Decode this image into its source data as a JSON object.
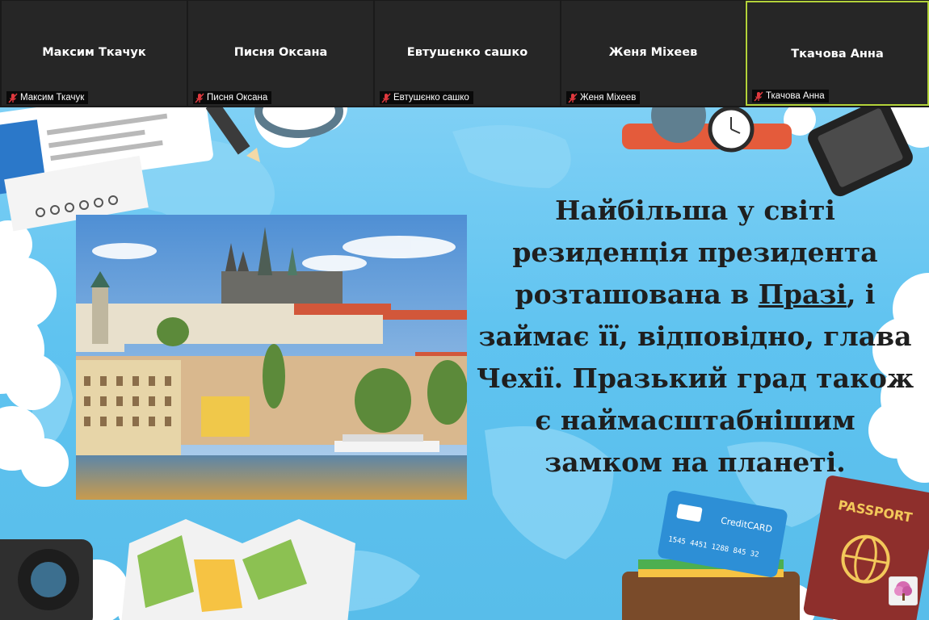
{
  "participants": [
    {
      "display_name": "Максим Ткачук",
      "label": "Максим Ткачук",
      "muted": true,
      "active": false
    },
    {
      "display_name": "Писня Оксана",
      "label": "Писня Оксана",
      "muted": true,
      "active": false
    },
    {
      "display_name": "Евтушєнко сашко",
      "label": "Евтушєнко сашко",
      "muted": true,
      "active": false
    },
    {
      "display_name": "Женя Міхеев",
      "label": "Женя Міхеев",
      "muted": true,
      "active": false
    },
    {
      "display_name": "Ткачова Анна",
      "label": "Ткачова Анна",
      "muted": true,
      "active": true
    }
  ],
  "slide": {
    "text_before": "Найбільша у світі резиденція президента розташована в ",
    "text_link": "Празі",
    "text_after": ", і займає її, відповідно, глава Чехії. Празький град також є наймасштабнішим замком на планеті.",
    "card_text": "CreditCARD",
    "card_number": "1545 4451 1288 845 32",
    "passport_text": "PASSPORT"
  },
  "colors": {
    "active_speaker": "#b3d23a",
    "slide_background": "#5fc3f0",
    "muted_icon": "#e0393e"
  }
}
